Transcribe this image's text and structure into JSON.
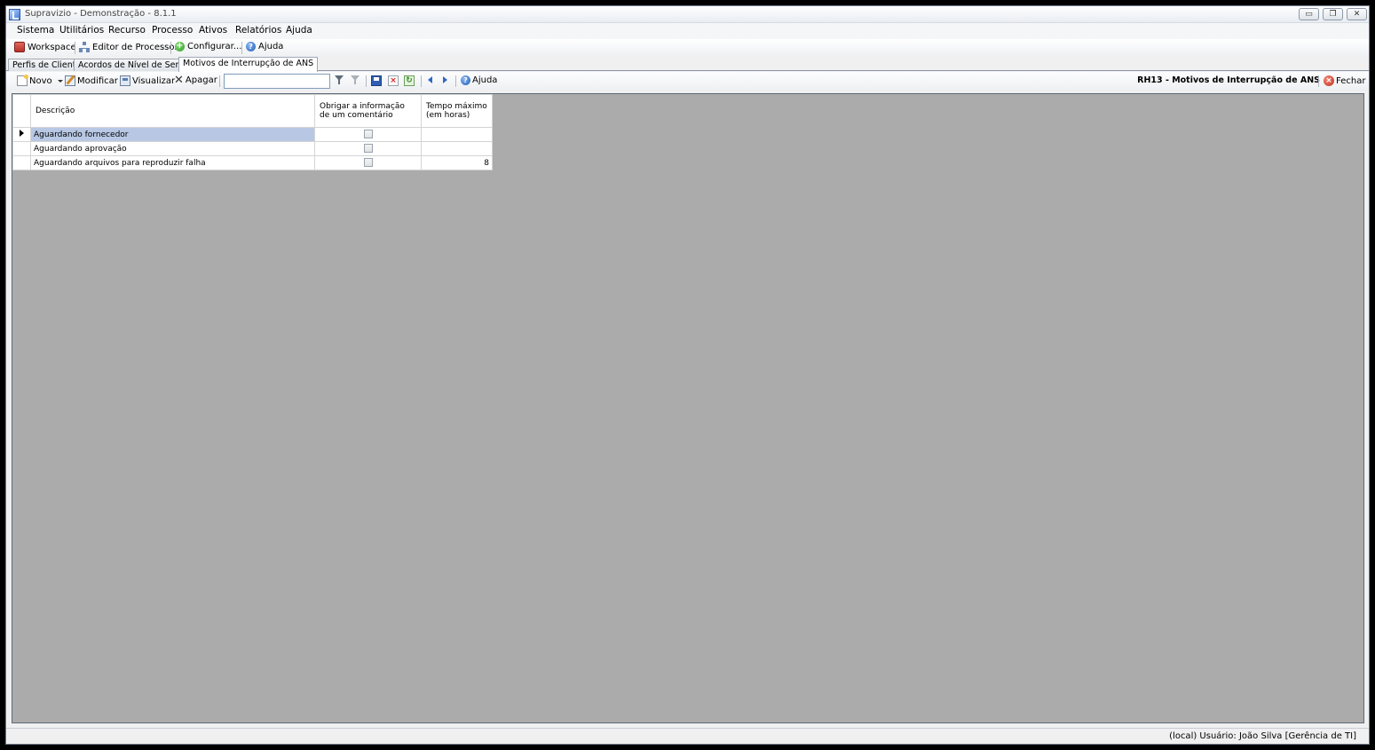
{
  "window": {
    "title": "Supravizio - Demonstração - 8.1.1",
    "minimize": "▭",
    "restore": "❐",
    "close": "✕"
  },
  "menu": {
    "items": [
      "Sistema",
      "Utilitários",
      "Recurso",
      "Processo",
      "Ativos",
      "Relatórios",
      "Ajuda"
    ]
  },
  "quickbar": {
    "workspace": "Workspace",
    "process_editor": "Editor de Processos",
    "configure": "Configurar...",
    "help": "Ajuda"
  },
  "tabs": [
    {
      "label": "Perfis de Clientes",
      "active": false
    },
    {
      "label": "Acordos de Nível de Serviço",
      "active": false
    },
    {
      "label": "Motivos de Interrupção de ANS",
      "active": true
    }
  ],
  "actionbar": {
    "new": "Novo",
    "modify": "Modificar",
    "view": "Visualizar",
    "delete": "Apagar",
    "search_value": "",
    "help": "Ajuda",
    "screen_title": "RH13 - Motivos de Interrupção de ANS",
    "close": "Fechar"
  },
  "grid": {
    "columns": [
      "Descrição",
      "Obrigar a informação de um comentário",
      "Tempo máximo (em horas)"
    ],
    "rows": [
      {
        "description": "Aguardando fornecedor",
        "require_comment": false,
        "max_hours": "",
        "selected": true
      },
      {
        "description": "Aguardando aprovação",
        "require_comment": false,
        "max_hours": "",
        "selected": false
      },
      {
        "description": "Aguardando arquivos para reproduzir falha",
        "require_comment": false,
        "max_hours": "8",
        "selected": false
      }
    ]
  },
  "status": {
    "text": "(local)  Usuário: João Silva [Gerência de TI]"
  }
}
